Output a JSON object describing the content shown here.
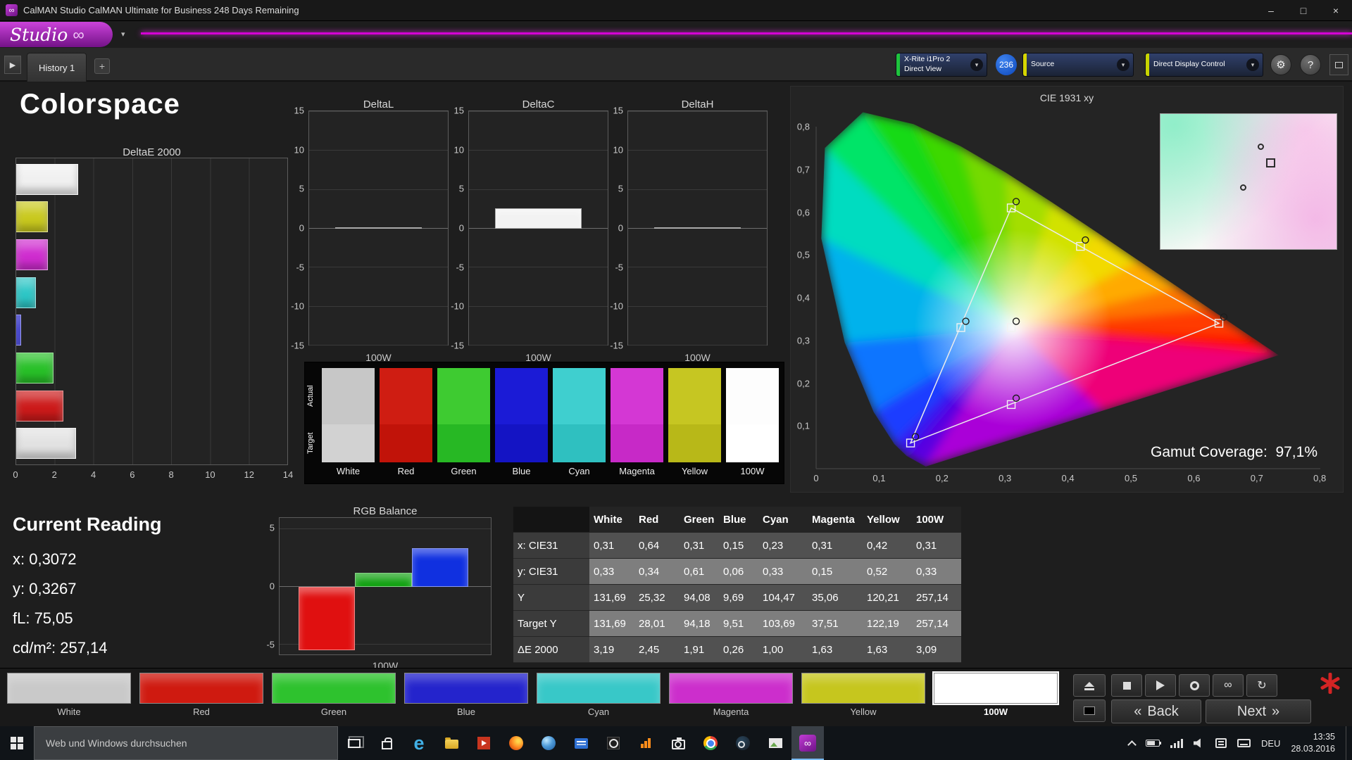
{
  "window": {
    "title": "CalMAN Studio CalMAN Ultimate for Business 248 Days Remaining",
    "minimize": "–",
    "maximize": "□",
    "close": "×"
  },
  "logo": {
    "text": "Studio"
  },
  "icons": {
    "caret": "▾",
    "gear": "⚙",
    "help": "?",
    "infinity": "∞",
    "refresh": "↻",
    "panel_arrow": "▶"
  },
  "tabs": {
    "history": "History 1",
    "add": "+"
  },
  "toolbar": {
    "meter": {
      "line1": "X-Rite i1Pro 2",
      "line2": "Direct View",
      "accent": "#19c launch"
    },
    "badge": "236",
    "source": {
      "label": "Source",
      "accent": "#d6d600"
    },
    "display": {
      "label": "Direct Display Control",
      "accent": "#c8d400"
    }
  },
  "page": {
    "title": "Colorspace"
  },
  "chart_data": [
    {
      "id": "deltae-2000",
      "type": "bar",
      "orientation": "horizontal",
      "title": "DeltaE 2000",
      "categories": [
        "White",
        "Yellow",
        "Magenta",
        "Cyan",
        "Blue",
        "Green",
        "Red",
        "100W"
      ],
      "values": [
        3.19,
        1.63,
        1.63,
        1.0,
        0.26,
        1.91,
        2.45,
        3.09
      ],
      "colors": [
        "#f0f0f0",
        "#c9c91e",
        "#cf2ccf",
        "#2cc6c6",
        "#2222dd",
        "#28c028",
        "#cc1a1a",
        "#e2e2e2"
      ],
      "xlim": [
        0,
        14
      ],
      "x_ticks": [
        0,
        2,
        4,
        6,
        8,
        10,
        12,
        14
      ]
    },
    {
      "id": "delta-l",
      "type": "bar",
      "title": "DeltaL",
      "xlabel": "100W",
      "categories": [
        "100W"
      ],
      "values": [
        0.05
      ],
      "ylim": [
        -15,
        15
      ],
      "y_ticks": [
        15,
        10,
        5,
        0,
        -5,
        -10,
        -15
      ],
      "color": "#f2f2f2"
    },
    {
      "id": "delta-c",
      "type": "bar",
      "title": "DeltaC",
      "xlabel": "100W",
      "categories": [
        "100W"
      ],
      "values": [
        2.6
      ],
      "ylim": [
        -15,
        15
      ],
      "y_ticks": [
        15,
        10,
        5,
        0,
        -5,
        -10,
        -15
      ],
      "color": "#f2f2f2"
    },
    {
      "id": "delta-h",
      "type": "bar",
      "title": "DeltaH",
      "xlabel": "100W",
      "categories": [
        "100W"
      ],
      "values": [
        0.05
      ],
      "ylim": [
        -15,
        15
      ],
      "y_ticks": [
        15,
        10,
        5,
        0,
        -5,
        -10,
        -15
      ],
      "color": "#f2f2f2"
    },
    {
      "id": "rgb-balance",
      "type": "bar",
      "title": "RGB Balance",
      "xlabel": "100W",
      "categories": [
        "Red",
        "Green",
        "Blue"
      ],
      "values": [
        -5.4,
        1.2,
        3.3
      ],
      "colors": [
        "#e01010",
        "#10a010",
        "#1030e0"
      ],
      "ylim": [
        -5.9,
        5.9
      ],
      "y_ticks": [
        5,
        0,
        -5
      ]
    },
    {
      "id": "cie-1931",
      "type": "scatter",
      "title": "CIE 1931 xy",
      "xlim": [
        0,
        0.8
      ],
      "ylim": [
        0,
        0.8
      ],
      "annotation": "Gamut Coverage: 97,1%",
      "points": [
        {
          "label": "White",
          "x": 0.31,
          "y": 0.33
        },
        {
          "label": "Red",
          "x": 0.64,
          "y": 0.34
        },
        {
          "label": "Green",
          "x": 0.31,
          "y": 0.61
        },
        {
          "label": "Blue",
          "x": 0.15,
          "y": 0.06
        },
        {
          "label": "Cyan",
          "x": 0.23,
          "y": 0.33
        },
        {
          "label": "Magenta",
          "x": 0.31,
          "y": 0.15
        },
        {
          "label": "Yellow",
          "x": 0.42,
          "y": 0.52
        }
      ]
    }
  ],
  "patches": {
    "row_labels": [
      "Actual",
      "Target"
    ],
    "items": [
      {
        "label": "White",
        "actual": "#c7c7c7",
        "target": "#d2d2d2"
      },
      {
        "label": "Red",
        "actual": "#cf1d12",
        "target": "#c11309"
      },
      {
        "label": "Green",
        "actual": "#3ecb31",
        "target": "#27b824"
      },
      {
        "label": "Blue",
        "actual": "#1b1bd6",
        "target": "#1414c4"
      },
      {
        "label": "Cyan",
        "actual": "#3fcfcf",
        "target": "#2fc0c0"
      },
      {
        "label": "Magenta",
        "actual": "#d437d4",
        "target": "#c729c7"
      },
      {
        "label": "Yellow",
        "actual": "#c6c622",
        "target": "#b8b818"
      },
      {
        "label": "100W",
        "actual": "#fdfdfd",
        "target": "#ffffff"
      }
    ]
  },
  "cie": {
    "title": "CIE 1931 xy",
    "coverage_label": "Gamut Coverage:",
    "coverage_value": "97,1%",
    "x_ticks": [
      "0",
      "0,1",
      "0,2",
      "0,3",
      "0,4",
      "0,5",
      "0,6",
      "0,7",
      "0,8"
    ],
    "y_ticks": [
      "0,8",
      "0,7",
      "0,6",
      "0,5",
      "0,4",
      "0,3",
      "0,2",
      "0,1"
    ]
  },
  "current_reading": {
    "title": "Current Reading",
    "lines": [
      "x: 0,3072",
      "y: 0,3267",
      "fL: 75,05",
      "cd/m²: 257,14"
    ]
  },
  "table": {
    "columns": [
      "",
      "White",
      "Red",
      "Green",
      "Blue",
      "Cyan",
      "Magenta",
      "Yellow",
      "100W"
    ],
    "rows": [
      {
        "label": "x: CIE31",
        "values": [
          "0,31",
          "0,64",
          "0,31",
          "0,15",
          "0,23",
          "0,31",
          "0,42",
          "0,31"
        ]
      },
      {
        "label": "y: CIE31",
        "values": [
          "0,33",
          "0,34",
          "0,61",
          "0,06",
          "0,33",
          "0,15",
          "0,52",
          "0,33"
        ]
      },
      {
        "label": "Y",
        "values": [
          "131,69",
          "25,32",
          "94,08",
          "9,69",
          "104,47",
          "35,06",
          "120,21",
          "257,14"
        ]
      },
      {
        "label": "Target Y",
        "values": [
          "131,69",
          "28,01",
          "94,18",
          "9,51",
          "103,69",
          "37,51",
          "122,19",
          "257,14"
        ]
      },
      {
        "label": "ΔE 2000",
        "values": [
          "3,19",
          "2,45",
          "1,91",
          "0,26",
          "1,00",
          "1,63",
          "1,63",
          "3,09"
        ]
      }
    ]
  },
  "bottom_patches": [
    {
      "label": "White",
      "color": "#c9c9c9",
      "selected": false
    },
    {
      "label": "Red",
      "color": "#cf1a10",
      "selected": false
    },
    {
      "label": "Green",
      "color": "#2ec22e",
      "selected": false
    },
    {
      "label": "Blue",
      "color": "#2424cc",
      "selected": false
    },
    {
      "label": "Cyan",
      "color": "#38c8c8",
      "selected": false
    },
    {
      "label": "Magenta",
      "color": "#cc2ecc",
      "selected": false
    },
    {
      "label": "Yellow",
      "color": "#c6c61e",
      "selected": false
    },
    {
      "label": "100W",
      "color": "#ffffff",
      "selected": true
    }
  ],
  "transport": {
    "back": "Back",
    "next": "Next",
    "back_chevrons": "«",
    "next_chevrons": "»"
  },
  "taskbar": {
    "search_placeholder": "Web und Windows durchsuchen",
    "language": "DEU",
    "time": "13:35",
    "date": "28.03.2016"
  }
}
